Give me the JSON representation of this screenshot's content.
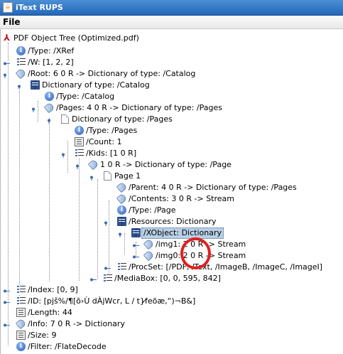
{
  "window": {
    "title": "iText RUPS"
  },
  "menu": {
    "file": "File"
  },
  "tree": {
    "root_label": "PDF Object Tree (Optimized.pdf)",
    "nodes": [
      "/Type: /XRef",
      "/W: [1, 2, 2]",
      "/Root: 6 0 R -> Dictionary of type: /Catalog",
      "Dictionary of type: /Catalog",
      "/Type: /Catalog",
      "/Pages: 4 0 R -> Dictionary of type: /Pages",
      "Dictionary of type: /Pages",
      "/Type: /Pages",
      "/Count: 1",
      "/Kids: [1 0 R]",
      "1 0 R -> Dictionary of type: /Page",
      "Page 1",
      "/Parent: 4 0 R -> Dictionary of type: /Pages",
      "/Contents: 3 0 R -> Stream",
      "/Type: /Page",
      "/Resources: Dictionary",
      "/XObject: Dictionary",
      "/img1: 2 0 R -> Stream",
      "/img0: 2 0 R -> Stream",
      "/ProcSet: [/PDF, /Text, /ImageB, /ImageC, /ImageI]",
      "/MediaBox: [0, 0, 595, 842]",
      "/Index: [0, 9]",
      "/ID: [pjš%/¶[õ›Ù  dÀjWcr, L  /  t}f̸eõæ,“)¬B&]",
      "/Length: 44",
      "/Info: 7 0 R -> Dictionary",
      "/Size: 9",
      "/Filter: /FlateDecode"
    ],
    "selected_node": "/XObject: Dictionary"
  },
  "annotation": {
    "color": "#e02020"
  }
}
